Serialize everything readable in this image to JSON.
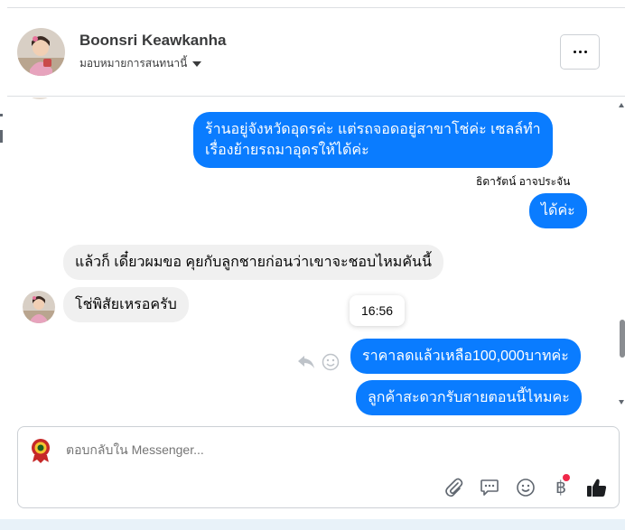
{
  "header": {
    "contact_name": "Boonsri Keawkanha",
    "assign_label": "มอบหมายการสนทนานี้"
  },
  "conversation": {
    "messages": [
      {
        "id": "m1",
        "direction": "outgoing",
        "lines": [
          "ร้านอยู่จังหวัดอุดรค่ะ แต่รถจอดอยู่สาขาโช่ค่ะ เซลล์ทำ",
          "เรื่องย้ายรถมาอุดรให้ได้ค่ะ"
        ]
      },
      {
        "id": "m2",
        "direction": "outgoing",
        "text": "ได้ค่ะ",
        "sender": "ธิดารัตน์ อาจประจัน"
      },
      {
        "id": "m3",
        "direction": "incoming",
        "text": "แล้วก็ เดี๋ยวผมขอ คุยกับลูกชายก่อนว่าเขาจะชอบไหมคันนี้"
      },
      {
        "id": "m4",
        "direction": "incoming",
        "text": "โช่พิสัยเหรอครับ"
      },
      {
        "id": "m5",
        "direction": "outgoing",
        "text": "ราคาลดแล้วเหลือ100,000บาทค่ะ"
      },
      {
        "id": "m6",
        "direction": "outgoing",
        "text": "ลูกค้าสะดวกรับสายตอนนี้ไหมคะ"
      }
    ],
    "hover_timestamp": "16:56"
  },
  "composer": {
    "placeholder": "ตอบกลับใน Messenger..."
  },
  "icons": {
    "more": "ellipsis-icon",
    "dropdown": "caret-down-icon",
    "reply": "reply-icon",
    "react": "smiley-icon",
    "attach": "paperclip-icon",
    "saved_replies": "chat-bubble-icon",
    "emoji": "smiley-icon",
    "payment": "baht-icon",
    "like": "thumbs-up-icon"
  },
  "colors": {
    "outgoing_bubble": "#0a7cff",
    "incoming_bubble": "#f0f0f0",
    "notification_dot": "#f02849"
  }
}
